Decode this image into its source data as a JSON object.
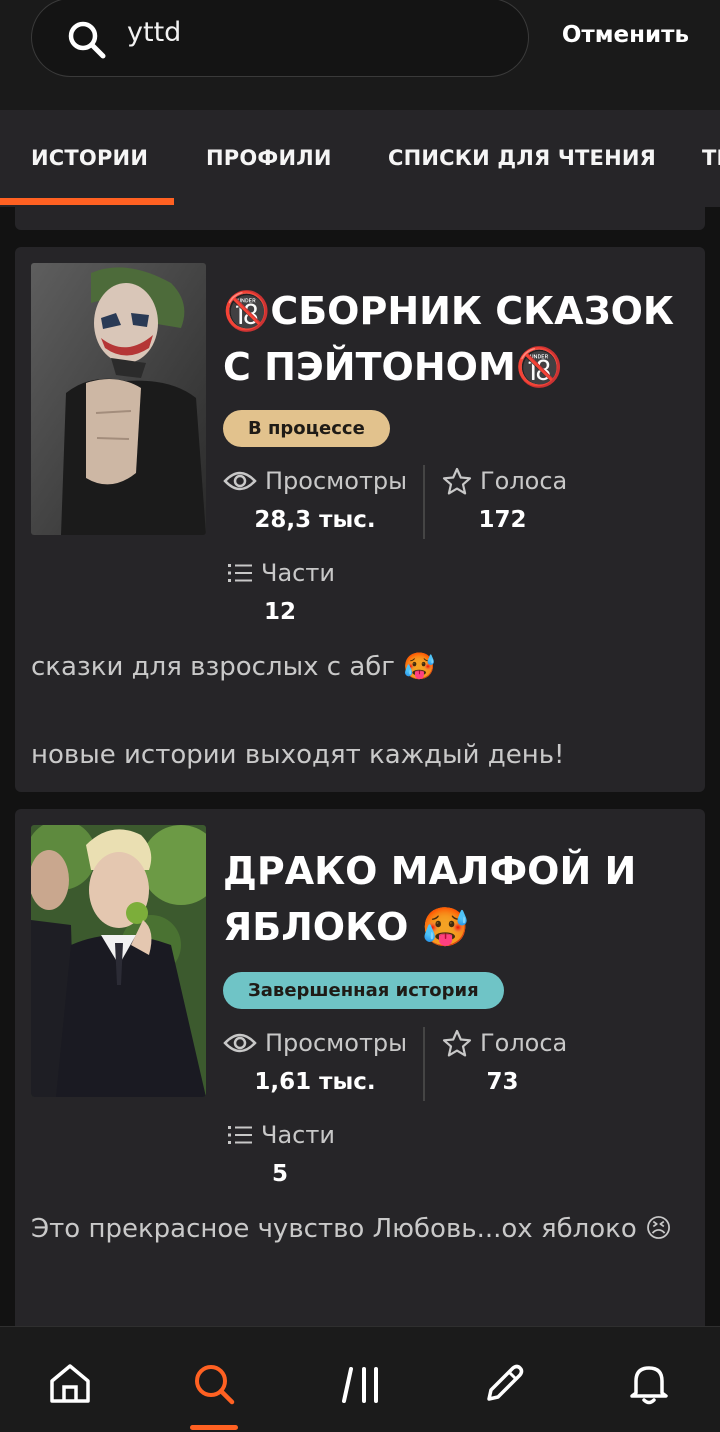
{
  "search": {
    "query": "yttd",
    "cancel_label": "Отменить"
  },
  "tabs": [
    {
      "label": "ИСТОРИИ",
      "active": true
    },
    {
      "label": "ПРОФИЛИ",
      "active": false
    },
    {
      "label": "СПИСКИ ДЛЯ ЧТЕНИЯ",
      "active": false
    },
    {
      "label": "ТЕ",
      "active": false
    }
  ],
  "stories": [
    {
      "title": "🔞СБОРНИК СКАЗОК С ПЭЙТОНОМ🔞",
      "status": "В процессе",
      "status_color": "#e2c28d",
      "views_label": "Просмотры",
      "views": "28,3 тыс.",
      "votes_label": "Голоса",
      "votes": "172",
      "parts_label": "Части",
      "parts": "12",
      "description": "сказки для взрослых с абг 🥵\n\nновые истории выходят каждый день!"
    },
    {
      "title": "ДРАКО МАЛФОЙ И ЯБЛОКО 🥵",
      "status": "Завершенная история",
      "status_color": "#6fc4c6",
      "views_label": "Просмотры",
      "views": "1,61 тыс.",
      "votes_label": "Голоса",
      "votes": "73",
      "parts_label": "Части",
      "parts": "5",
      "description": "Это прекрасное чувство Любовь...ох яблоко 😣"
    }
  ],
  "bottom_nav": [
    {
      "icon": "home-icon",
      "active": false
    },
    {
      "icon": "search-icon",
      "active": true
    },
    {
      "icon": "library-icon",
      "active": false
    },
    {
      "icon": "write-icon",
      "active": false
    },
    {
      "icon": "notifications-icon",
      "active": false
    }
  ],
  "colors": {
    "accent": "#ff6122",
    "card": "#262528",
    "background": "#121212"
  }
}
